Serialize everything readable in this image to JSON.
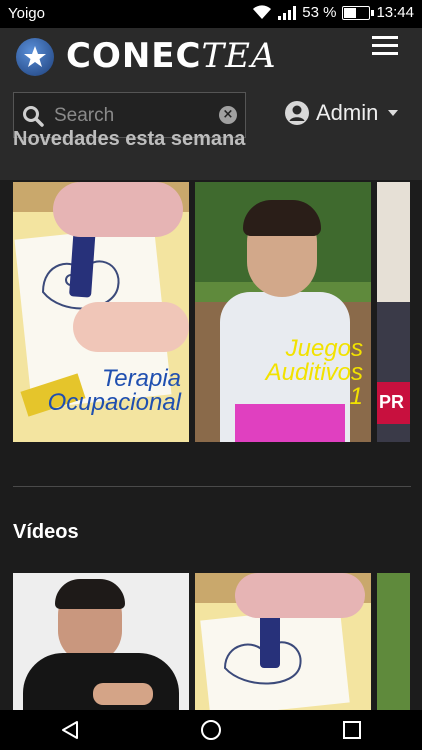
{
  "status_bar": {
    "carrier": "Yoigo",
    "battery": "53 %",
    "battery_level": 0.53,
    "time": "13:44"
  },
  "header": {
    "logo_bold": "CONEC",
    "logo_italic": "TEA",
    "search_placeholder": "Search",
    "user_label": "Admin"
  },
  "sections": {
    "new_this_week": {
      "title": "Novedades esta semana",
      "cards": [
        {
          "caption_lines": [
            "Terapia",
            "Ocupacional"
          ]
        },
        {
          "caption_lines": [
            "Juegos",
            "Auditivos",
            "1"
          ]
        },
        {
          "caption_lines": [
            "PR"
          ]
        }
      ]
    },
    "videos": {
      "title": "Vídeos"
    }
  },
  "icons": {
    "logo": "puzzle-star-logo",
    "menu": "hamburger-menu-icon",
    "search": "search-icon",
    "clear": "clear-icon",
    "user": "user-icon",
    "nav_back": "back-triangle-icon",
    "nav_home": "home-circle-icon",
    "nav_recent": "recent-square-icon"
  },
  "colors": {
    "background": "#1c1c1c",
    "header": "#2a2a2a",
    "caption_blue": "#1f4fb0",
    "caption_yellow": "#f2e200"
  }
}
